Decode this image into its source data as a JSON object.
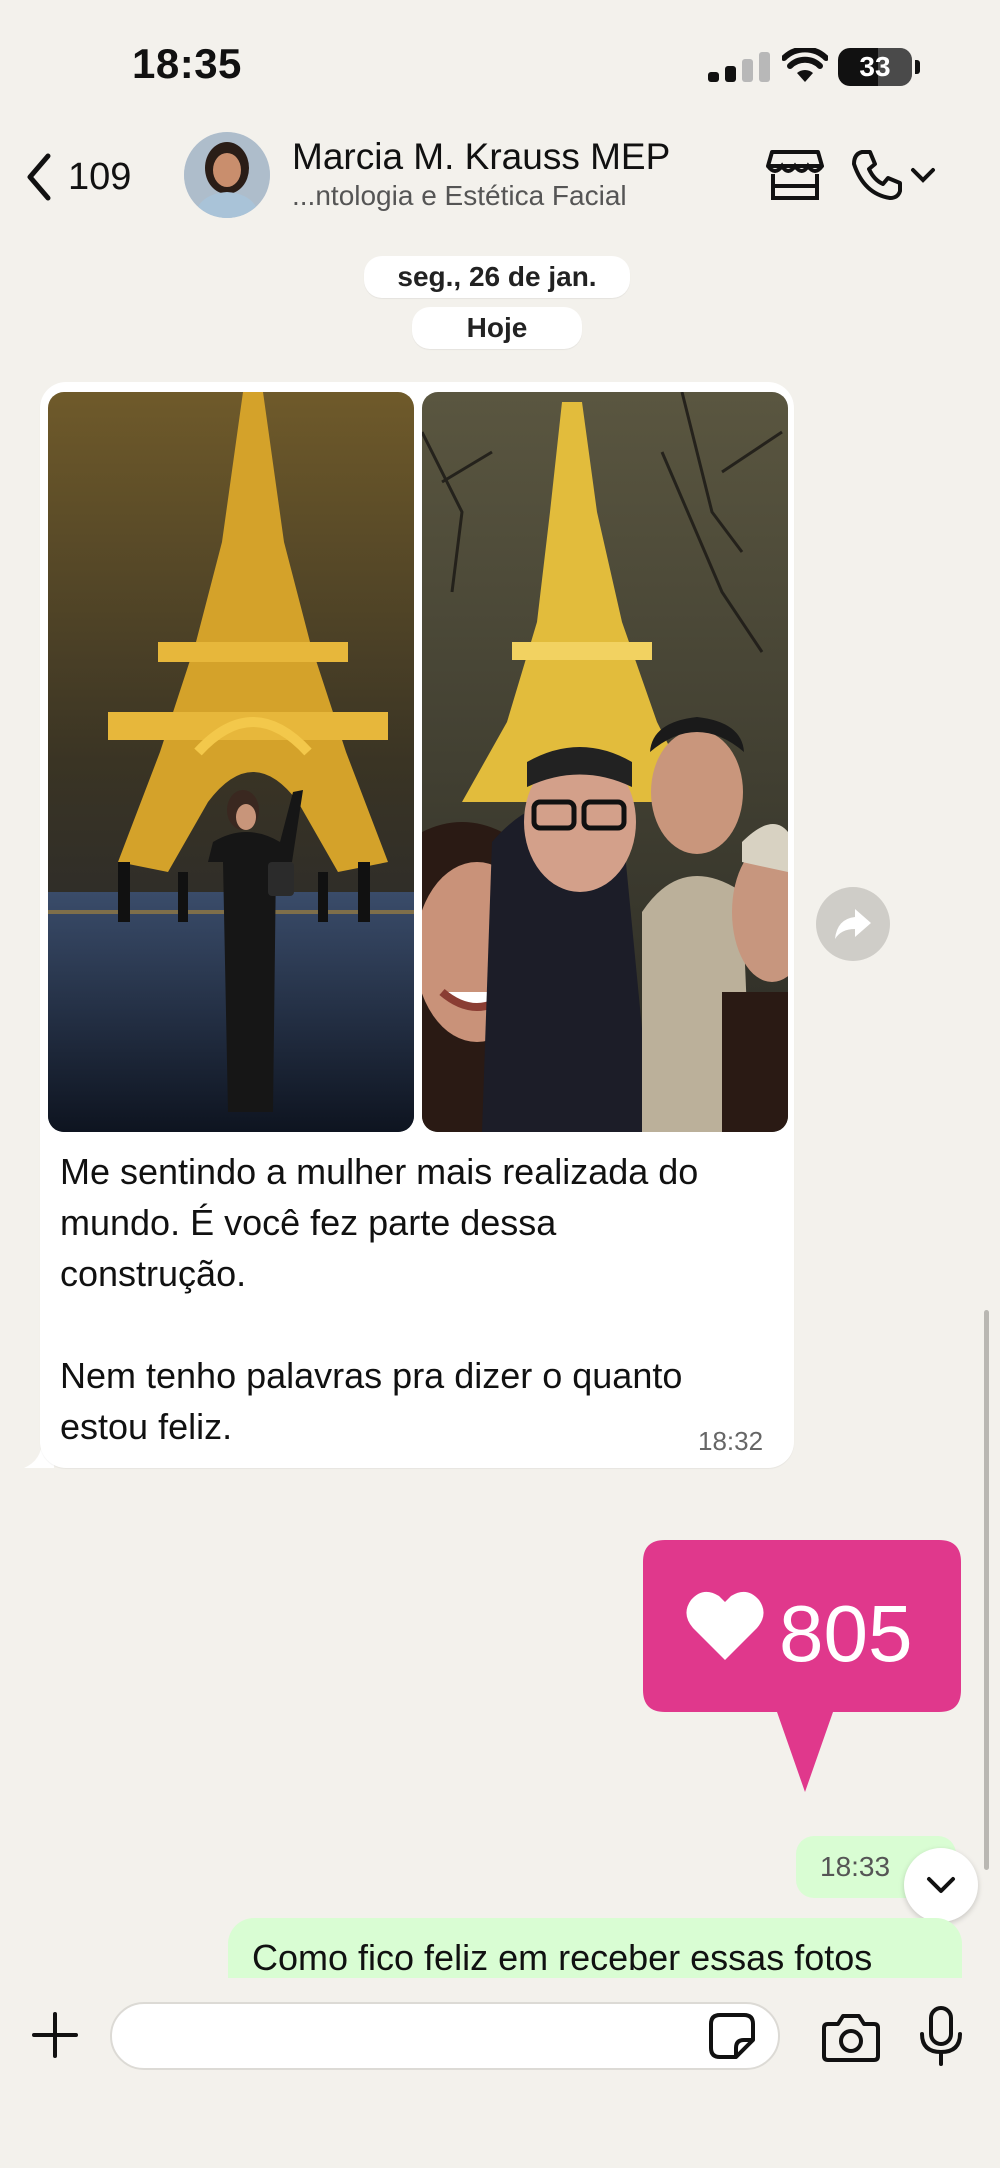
{
  "status_bar": {
    "time": "18:35",
    "battery": "33"
  },
  "header": {
    "back_count": "109",
    "contact_name": "Marcia M. Krauss MEP",
    "contact_subtitle": "...ntologia e Estética  Facial"
  },
  "chat": {
    "date_label": "seg., 26 de jan.",
    "today_label": "Hoje",
    "incoming": {
      "text": "Me sentindo a mulher mais realizada do\nmundo. É você fez parte dessa\nconstrução.\n\nNem tenho palavras pra dizer o quanto\nestou feliz.",
      "time": "18:32"
    },
    "sticker": {
      "likes": "805",
      "accent": "#e0388c"
    },
    "outgoing_time": "18:33",
    "outgoing_text": "Como fico feliz em receber essas fotos"
  },
  "composer": {
    "placeholder": ""
  },
  "colors": {
    "background": "#f3f1ec",
    "outgoing_bubble": "#d9fdd3",
    "incoming_bubble": "#ffffff"
  }
}
